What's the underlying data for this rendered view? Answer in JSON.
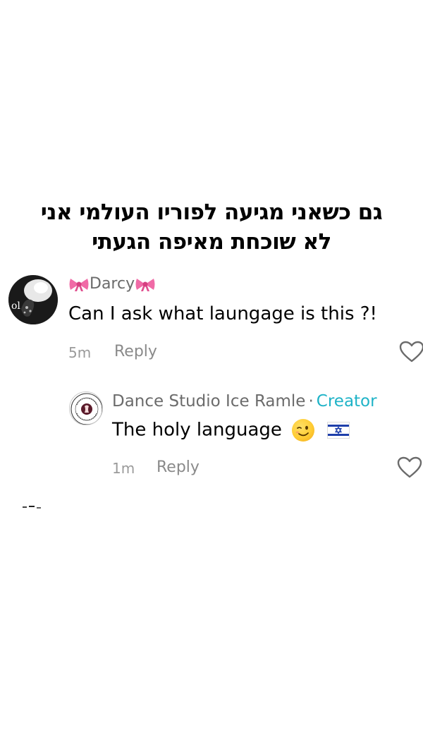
{
  "caption": {
    "line1": "גם כשאני מגיעה לפוריו העולמי אני",
    "line2": "לא שוכחת מאיפה הגעתי"
  },
  "comment": {
    "username": "Darcy",
    "text": "Can I ask what laungage is this ?!",
    "time": "5m",
    "reply_label": "Reply"
  },
  "reply": {
    "username": "Dance Studio Ice Ramle",
    "separator": "·",
    "badge": "Creator",
    "text": "The holy language",
    "time": "1m",
    "reply_label": "Reply"
  },
  "colors": {
    "creator_badge": "#1fb3c7",
    "meta_text": "#8a8a8a",
    "username_text": "#6b6b6b"
  },
  "icons": {
    "like": "heart-outline-icon",
    "bow": "ribbon-bow-emoji",
    "wink": "winking-face-emoji",
    "flag": "israel-flag-emoji"
  }
}
